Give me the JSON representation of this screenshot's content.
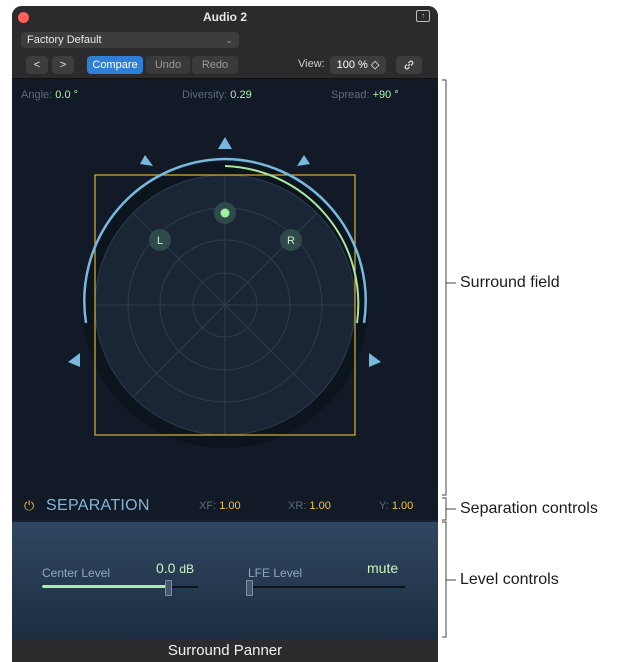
{
  "window": {
    "title": "Audio 2"
  },
  "preset": {
    "value": "Factory Default"
  },
  "toolbar": {
    "prev_icon": "<",
    "next_icon": ">",
    "compare_label": "Compare",
    "undo_label": "Undo",
    "redo_label": "Redo",
    "view_label": "View:",
    "view_value": "100 % ◇",
    "link_icon": "link-icon"
  },
  "params": {
    "angle_label": "Angle:",
    "angle_value": "0.0 °",
    "diversity_label": "Diversity:",
    "diversity_value": "0.29",
    "spread_label": "Spread:",
    "spread_value": "+90 °"
  },
  "field": {
    "left_label": "L",
    "right_label": "R"
  },
  "separation": {
    "title": "SEPARATION",
    "xf_label": "XF:",
    "xf_value": "1.00",
    "xr_label": "XR:",
    "xr_value": "1.00",
    "y_label": "Y:",
    "y_value": "1.00"
  },
  "levels": {
    "center_label": "Center Level",
    "center_value": "0.0",
    "center_unit": "dB",
    "center_fraction": 0.8,
    "lfe_label": "LFE Level",
    "lfe_value": "mute",
    "lfe_fraction": 0.0
  },
  "footer": {
    "title": "Surround Panner"
  },
  "callouts": {
    "surround_field": "Surround field",
    "separation_controls": "Separation controls",
    "level_controls": "Level controls"
  },
  "colors": {
    "accent": "#2f7fd6",
    "value_green": "#b3efb4",
    "separation_yellow": "#f0c342",
    "box_yellow": "#d7b43a",
    "spread_blue": "#78b8dd"
  }
}
